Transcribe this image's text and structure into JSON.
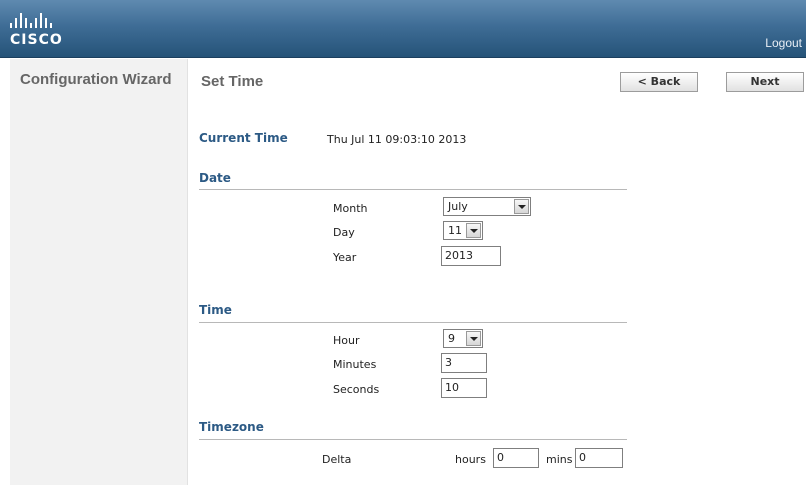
{
  "header": {
    "logo_text": "CISCO",
    "logout_label": "Logout"
  },
  "sidebar": {
    "title": "Configuration Wizard"
  },
  "main": {
    "page_title": "Set Time",
    "back_label": "< Back",
    "next_label": "Next",
    "current_time_label": "Current Time",
    "current_time_value": "Thu Jul 11 09:03:10 2013",
    "date": {
      "section_label": "Date",
      "month_label": "Month",
      "month_value": "July",
      "day_label": "Day",
      "day_value": "11",
      "year_label": "Year",
      "year_value": "2013"
    },
    "time": {
      "section_label": "Time",
      "hour_label": "Hour",
      "hour_value": "9",
      "minutes_label": "Minutes",
      "minutes_value": "3",
      "seconds_label": "Seconds",
      "seconds_value": "10"
    },
    "timezone": {
      "section_label": "Timezone",
      "delta_label": "Delta",
      "hours_label": "hours",
      "hours_value": "0",
      "mins_label": "mins",
      "mins_value": "0"
    }
  },
  "colors": {
    "header_top": "#5f8ab0",
    "header_bottom": "#255378",
    "section_label": "#2c5a85",
    "sidebar_bg": "#f2f2f2"
  }
}
